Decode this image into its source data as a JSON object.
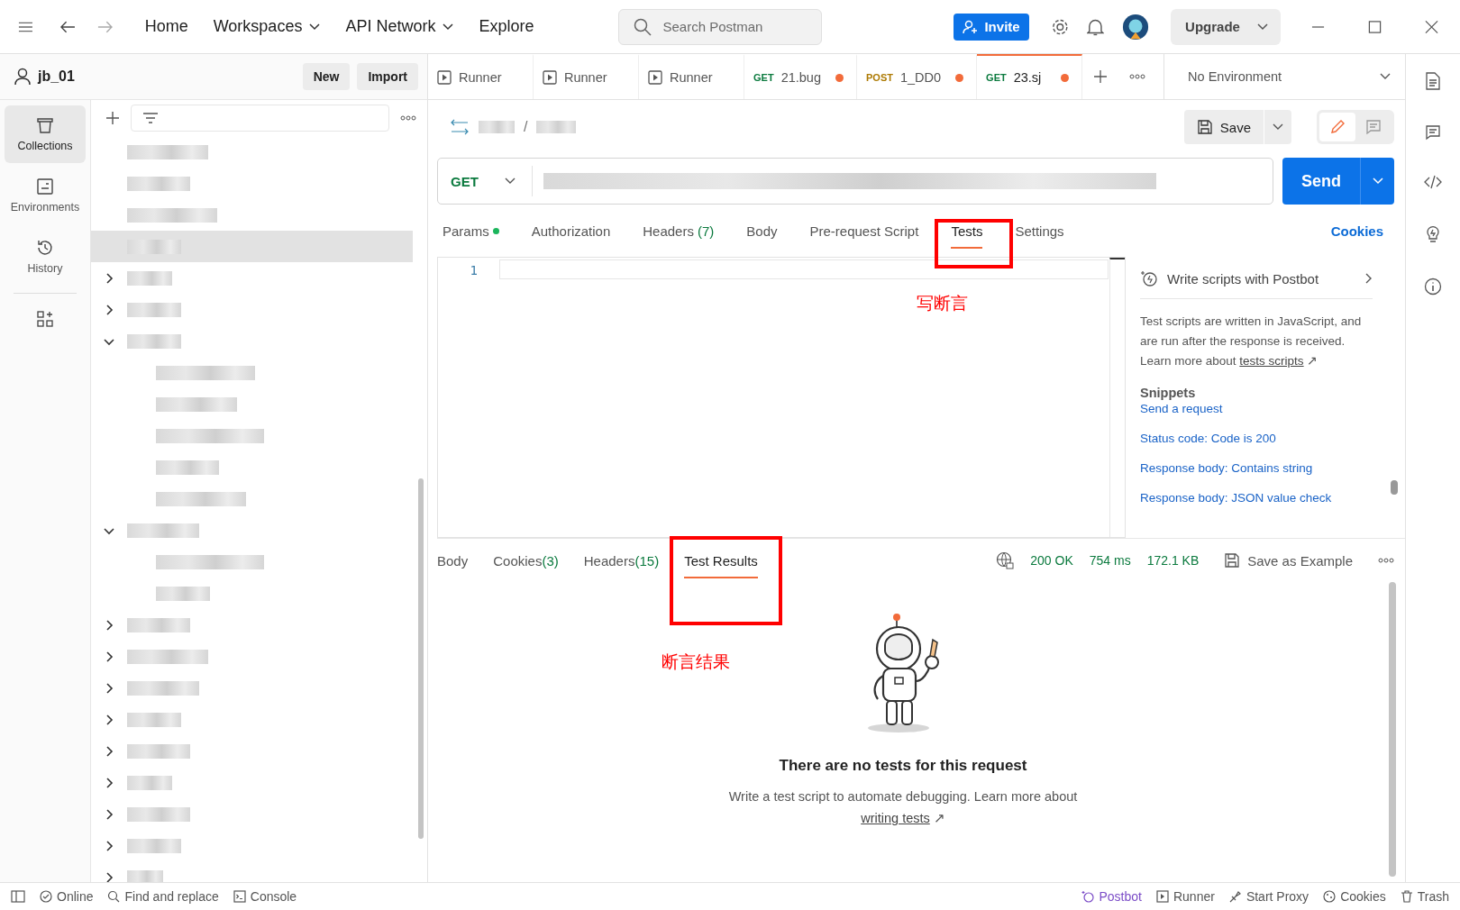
{
  "topbar": {
    "nav": [
      {
        "label": "Home",
        "dropdown": false
      },
      {
        "label": "Workspaces",
        "dropdown": true
      },
      {
        "label": "API Network",
        "dropdown": true
      },
      {
        "label": "Explore",
        "dropdown": false
      }
    ],
    "search_placeholder": "Search Postman",
    "invite": "Invite",
    "upgrade": "Upgrade"
  },
  "workspace": {
    "name": "jb_01",
    "buttons": [
      "New",
      "Import"
    ]
  },
  "rail": [
    {
      "kind": "collections",
      "label": "Collections",
      "selected": true
    },
    {
      "kind": "environments",
      "label": "Environments",
      "selected": false
    },
    {
      "kind": "history",
      "label": "History",
      "selected": false
    }
  ],
  "tree": [
    {
      "kind": "request",
      "selected": false
    },
    {
      "kind": "request",
      "selected": false
    },
    {
      "kind": "request",
      "selected": false
    },
    {
      "kind": "request",
      "selected": true
    },
    {
      "kind": "folder",
      "expanded": false
    },
    {
      "kind": "folder",
      "expanded": false
    },
    {
      "kind": "folder",
      "expanded": true,
      "children": [
        {
          "kind": "request",
          "selected": false
        },
        {
          "kind": "request",
          "selected": false
        },
        {
          "kind": "request",
          "selected": false
        },
        {
          "kind": "request",
          "selected": false
        },
        {
          "kind": "request",
          "selected": false
        }
      ]
    },
    {
      "kind": "folder",
      "expanded": true,
      "children": [
        {
          "kind": "request",
          "selected": false
        },
        {
          "kind": "request",
          "selected": false
        }
      ]
    },
    {
      "kind": "folder",
      "expanded": false
    },
    {
      "kind": "folder",
      "expanded": false
    },
    {
      "kind": "folder",
      "expanded": false
    },
    {
      "kind": "folder",
      "expanded": false
    },
    {
      "kind": "folder",
      "expanded": false
    },
    {
      "kind": "folder",
      "expanded": false
    },
    {
      "kind": "folder",
      "expanded": false
    },
    {
      "kind": "folder",
      "expanded": false
    },
    {
      "kind": "folder",
      "expanded": false
    }
  ],
  "tabs": [
    {
      "kind": "runner",
      "label": "Runner",
      "selected": false,
      "unsaved": false
    },
    {
      "kind": "runner",
      "label": "Runner",
      "selected": false,
      "unsaved": false
    },
    {
      "kind": "runner",
      "label": "Runner",
      "selected": false,
      "unsaved": false
    },
    {
      "kind": "request",
      "method": "GET",
      "label": "21.bug",
      "unsaved": true,
      "selected": false
    },
    {
      "kind": "request",
      "method": "POST",
      "label": "1_DD0",
      "unsaved": true,
      "selected": false
    },
    {
      "kind": "request",
      "method": "GET",
      "label": "23.sj",
      "unsaved": true,
      "selected": true
    }
  ],
  "environment": "No Environment",
  "request": {
    "path_separator": "/",
    "save": "Save",
    "method": "GET",
    "send": "Send",
    "tabs": [
      {
        "label": "Params",
        "dot": true,
        "selected": false
      },
      {
        "label": "Authorization",
        "dot": false,
        "selected": false
      },
      {
        "label": "Headers",
        "count": "(7)",
        "dot": false,
        "selected": false
      },
      {
        "label": "Body",
        "dot": false,
        "selected": false
      },
      {
        "label": "Pre-request Script",
        "dot": false,
        "selected": false
      },
      {
        "label": "Tests",
        "dot": false,
        "selected": true
      },
      {
        "label": "Settings",
        "dot": false,
        "selected": false
      }
    ],
    "cookies": "Cookies"
  },
  "editor": {
    "line_numbers": [
      "1"
    ]
  },
  "side_panel": {
    "postbot": "Write scripts with Postbot",
    "description": "Test scripts are written in JavaScript, and are run after the response is received. Learn more about",
    "link": "tests scripts",
    "link_arrow": "↗",
    "snippets_title": "Snippets",
    "snippets": [
      "Send a request",
      "Status code: Code is 200",
      "Response body: Contains string",
      "Response body: JSON value check"
    ]
  },
  "response": {
    "tabs": [
      {
        "label": "Body",
        "selected": false
      },
      {
        "label": "Cookies",
        "count": "(3)",
        "selected": false
      },
      {
        "label": "Headers",
        "count": "(15)",
        "selected": false
      },
      {
        "label": "Test Results",
        "selected": true
      }
    ],
    "status": "200 OK",
    "time": "754 ms",
    "size": "172.1 KB",
    "save_example": "Save as Example",
    "empty_title": "There are no tests for this request",
    "empty_text": "Write a test script to automate debugging. Learn more about",
    "empty_link": "writing tests",
    "link_arrow": "↗"
  },
  "annotations": [
    {
      "kind": "box"
    },
    {
      "kind": "label",
      "text": "写断言"
    },
    {
      "kind": "box"
    },
    {
      "kind": "label",
      "text": "断言结果"
    }
  ],
  "status_bar": {
    "left": [
      {
        "kind": "online",
        "label": "Online"
      },
      {
        "kind": "find",
        "label": "Find and replace"
      },
      {
        "kind": "console",
        "label": "Console"
      }
    ],
    "right": [
      {
        "kind": "postbot",
        "label": "Postbot"
      },
      {
        "kind": "runner",
        "label": "Runner"
      },
      {
        "kind": "proxy",
        "label": "Start Proxy"
      },
      {
        "kind": "cookies",
        "label": "Cookies"
      },
      {
        "kind": "trash",
        "label": "Trash"
      }
    ]
  }
}
